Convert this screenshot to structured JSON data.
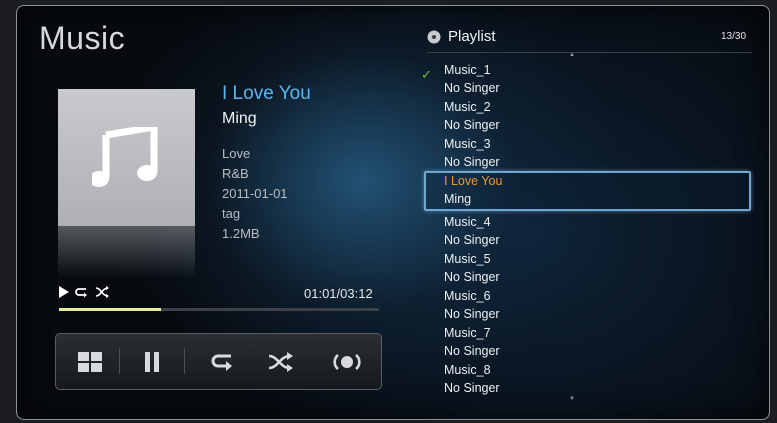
{
  "app": {
    "title": "Music"
  },
  "now_playing": {
    "title": "I Love You",
    "artist": "Ming",
    "album": "Love",
    "genre": "R&B",
    "date": "2011-01-01",
    "tag": "tag",
    "size": "1.2MB",
    "time": "01:01/03:12",
    "progress_fraction": 0.32
  },
  "status_icons": [
    "play-icon",
    "repeat-icon",
    "shuffle-off-icon"
  ],
  "controls": [
    "grid-icon",
    "pause-icon",
    "repeat-icon",
    "shuffle-icon",
    "sound-effect-icon"
  ],
  "playlist": {
    "title": "Playlist",
    "counter": "13/30",
    "items": [
      {
        "line1": "Music_1",
        "line2": "No Singer",
        "checked": true
      },
      {
        "line1": "Music_2",
        "line2": "No Singer"
      },
      {
        "line1": "Music_3",
        "line2": "No Singer"
      },
      {
        "line1": "I Love You",
        "line2": "Ming",
        "selected": true
      },
      {
        "line1": "Music_4",
        "line2": "No Singer"
      },
      {
        "line1": "Music_5",
        "line2": "No Singer"
      },
      {
        "line1": "Music_6",
        "line2": "No Singer"
      },
      {
        "line1": "Music_7",
        "line2": "No Singer"
      },
      {
        "line1": "Music_8",
        "line2": "No Singer"
      }
    ]
  },
  "colors": {
    "accent_title": "#59b7f0",
    "selected_title": "#e79a38",
    "check": "#69c03a",
    "progress": "#e9ec9a",
    "highlight_border": "#6fa6cf"
  }
}
